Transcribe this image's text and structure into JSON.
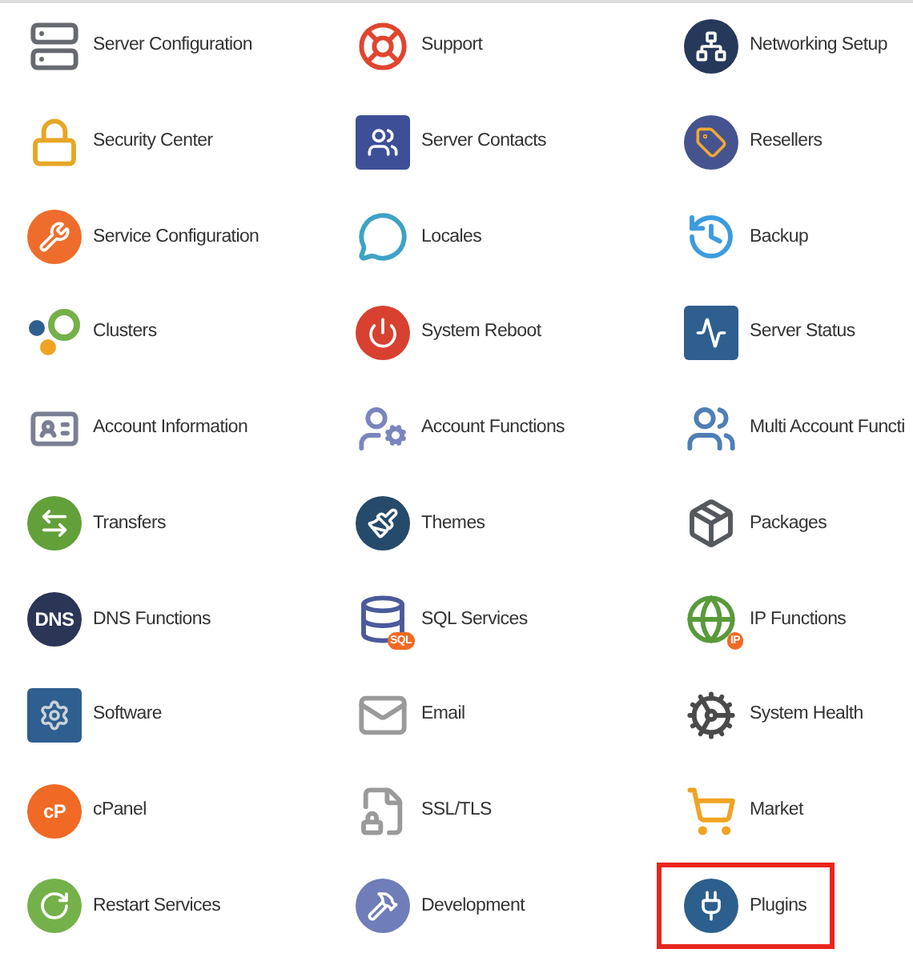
{
  "items": [
    {
      "label": "Server Configuration",
      "highlighted": false
    },
    {
      "label": "Support",
      "highlighted": false
    },
    {
      "label": "Networking Setup",
      "highlighted": false
    },
    {
      "label": "Security Center",
      "highlighted": false
    },
    {
      "label": "Server Contacts",
      "highlighted": false
    },
    {
      "label": "Resellers",
      "highlighted": false
    },
    {
      "label": "Service Configuration",
      "highlighted": false
    },
    {
      "label": "Locales",
      "highlighted": false
    },
    {
      "label": "Backup",
      "highlighted": false
    },
    {
      "label": "Clusters",
      "highlighted": false
    },
    {
      "label": "System Reboot",
      "highlighted": false
    },
    {
      "label": "Server Status",
      "highlighted": false
    },
    {
      "label": "Account Information",
      "highlighted": false
    },
    {
      "label": "Account Functions",
      "highlighted": false
    },
    {
      "label": "Multi Account Functi",
      "highlighted": false
    },
    {
      "label": "Transfers",
      "highlighted": false
    },
    {
      "label": "Themes",
      "highlighted": false
    },
    {
      "label": "Packages",
      "highlighted": false
    },
    {
      "label": "DNS Functions",
      "highlighted": false,
      "icon_label": "DNS"
    },
    {
      "label": "SQL Services",
      "highlighted": false,
      "icon_label": "SQL"
    },
    {
      "label": "IP Functions",
      "highlighted": false,
      "icon_label": "IP"
    },
    {
      "label": "Software",
      "highlighted": false
    },
    {
      "label": "Email",
      "highlighted": false
    },
    {
      "label": "System Health",
      "highlighted": false
    },
    {
      "label": "cPanel",
      "highlighted": false,
      "icon_label": "cP"
    },
    {
      "label": "SSL/TLS",
      "highlighted": false
    },
    {
      "label": "Market",
      "highlighted": false
    },
    {
      "label": "Restart Services",
      "highlighted": false
    },
    {
      "label": "Development",
      "highlighted": false
    },
    {
      "label": "Plugins",
      "highlighted": true
    }
  ]
}
